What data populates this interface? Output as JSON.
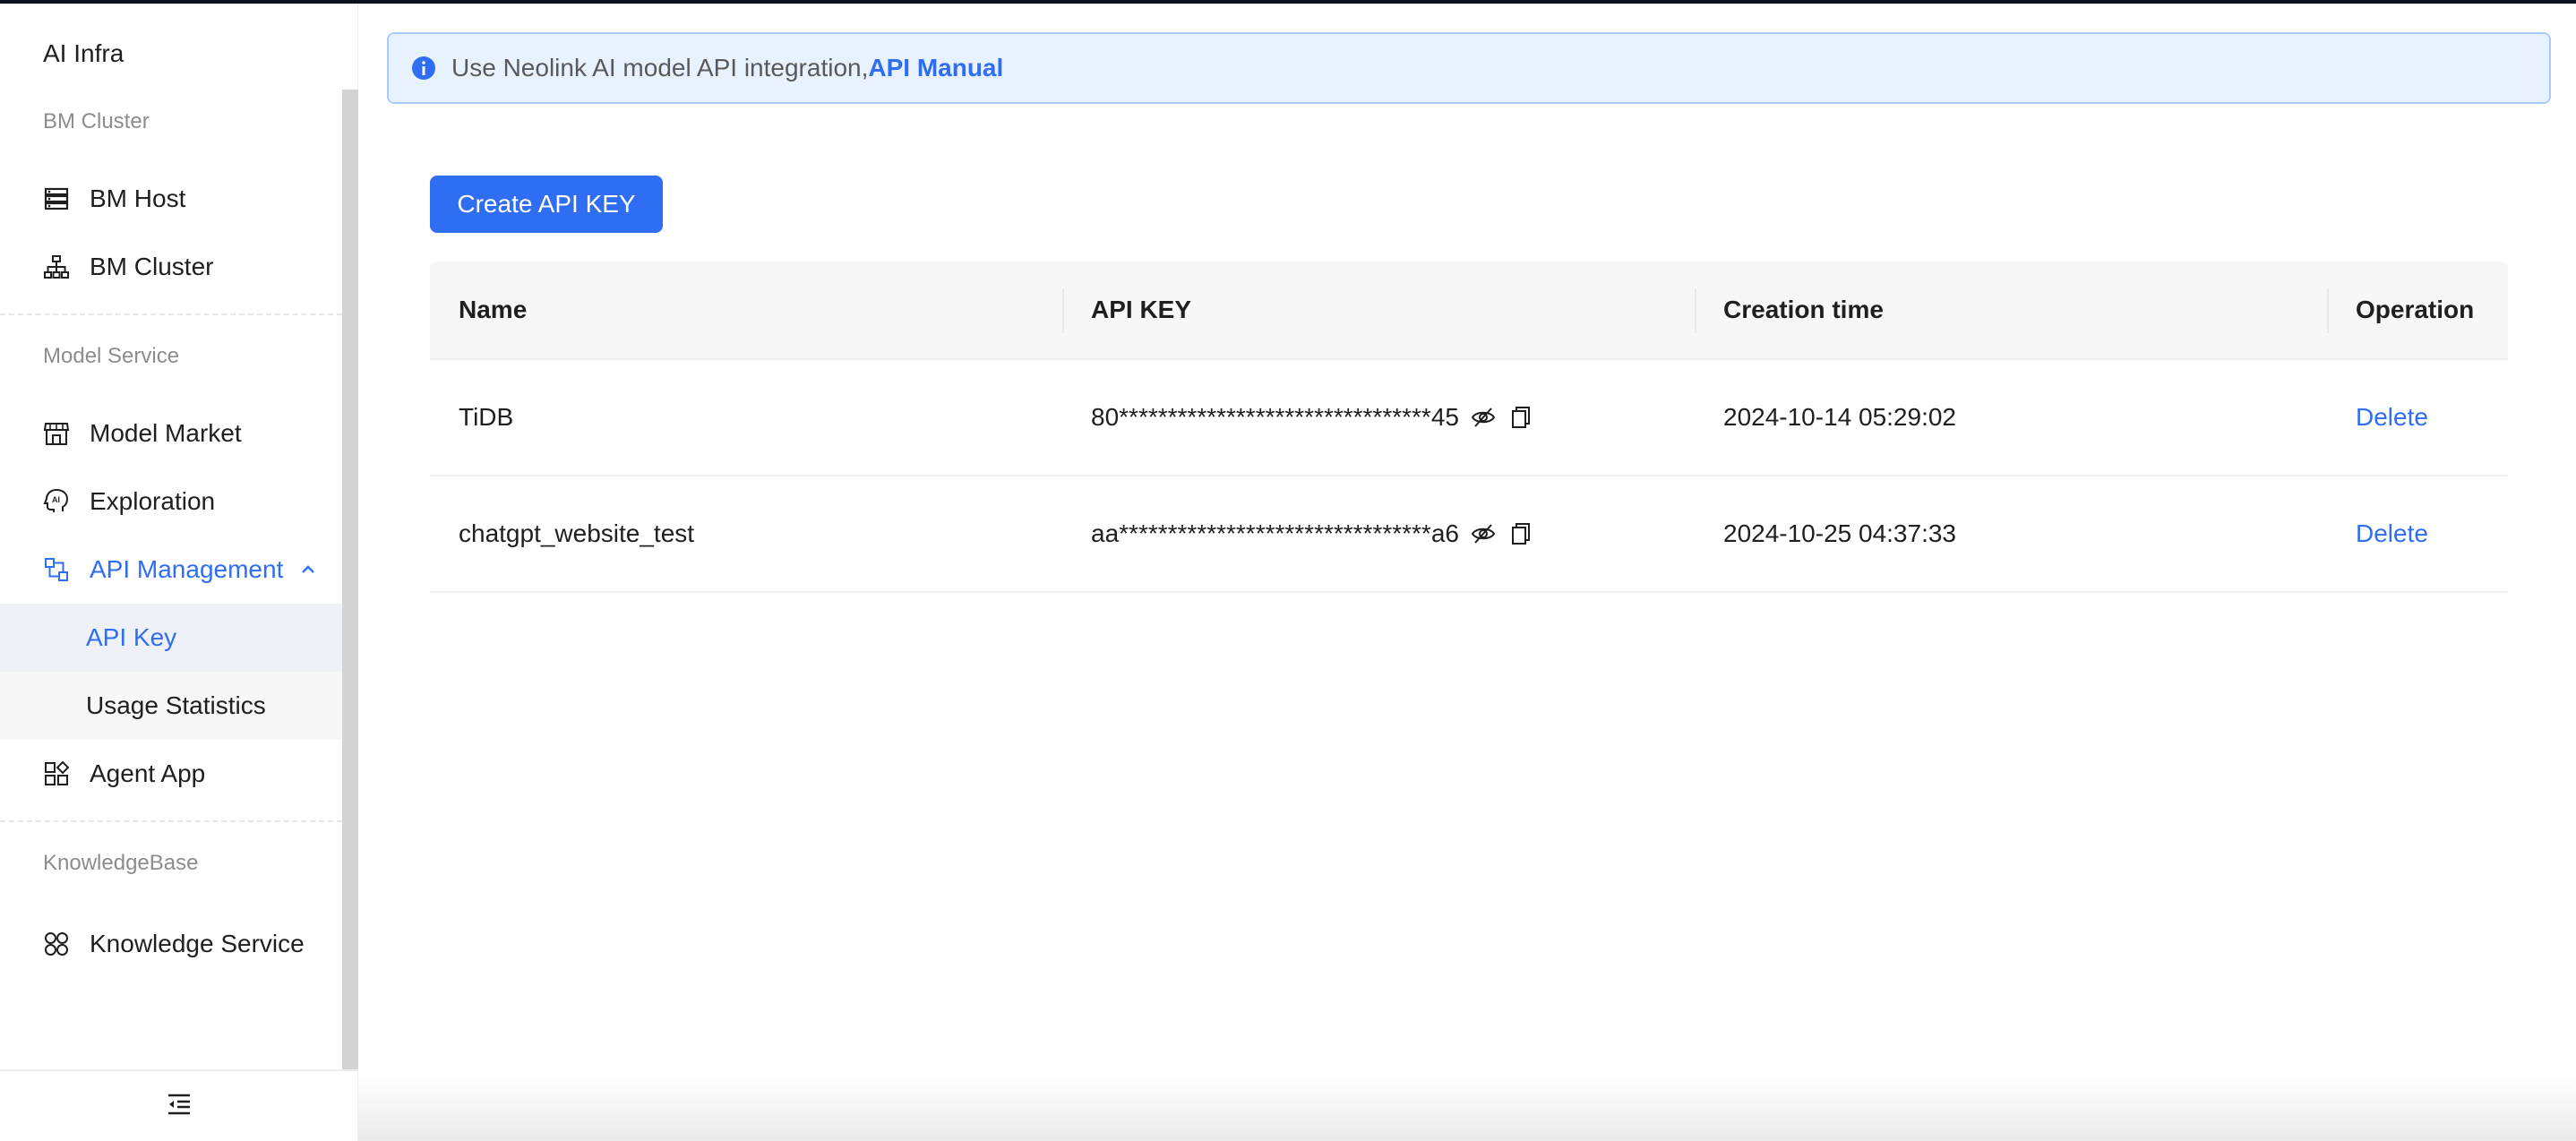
{
  "app": {
    "title": "AI Infra"
  },
  "sidebar": {
    "groups": [
      {
        "label": "BM Cluster"
      },
      {
        "label": "Model Service"
      },
      {
        "label": "KnowledgeBase"
      }
    ],
    "items": [
      {
        "label": "BM Host",
        "icon": "server-icon"
      },
      {
        "label": "BM Cluster",
        "icon": "cluster-icon"
      },
      {
        "label": "Model Market",
        "icon": "store-icon"
      },
      {
        "label": "Exploration",
        "icon": "ai-head-icon"
      },
      {
        "label": "API Management",
        "icon": "api-icon",
        "expanded": true
      },
      {
        "label": "Agent App",
        "icon": "apps-grid-icon"
      },
      {
        "label": "Knowledge Service",
        "icon": "knowledge-icon"
      }
    ],
    "sub_items": [
      {
        "label": "API Key",
        "selected": true
      },
      {
        "label": "Usage Statistics",
        "selected": false
      }
    ]
  },
  "notice": {
    "text": "Use Neolink AI model API integration,",
    "link_text": "API Manual"
  },
  "toolbar": {
    "create_label": "Create API KEY"
  },
  "table": {
    "headers": [
      "Name",
      "API KEY",
      "Creation time",
      "Operation"
    ],
    "rows": [
      {
        "name": "TiDB",
        "api_key": "80********************************45",
        "created": "2024-10-14 05:29:02",
        "operation": "Delete"
      },
      {
        "name": "chatgpt_website_test",
        "api_key": "aa********************************a6",
        "created": "2024-10-25 04:37:33",
        "operation": "Delete"
      }
    ]
  },
  "colors": {
    "accent": "#2f6ef2",
    "notice_bg": "#e8f2ff",
    "notice_border": "#a9cdfb",
    "header_bg": "#f7f7f7"
  }
}
